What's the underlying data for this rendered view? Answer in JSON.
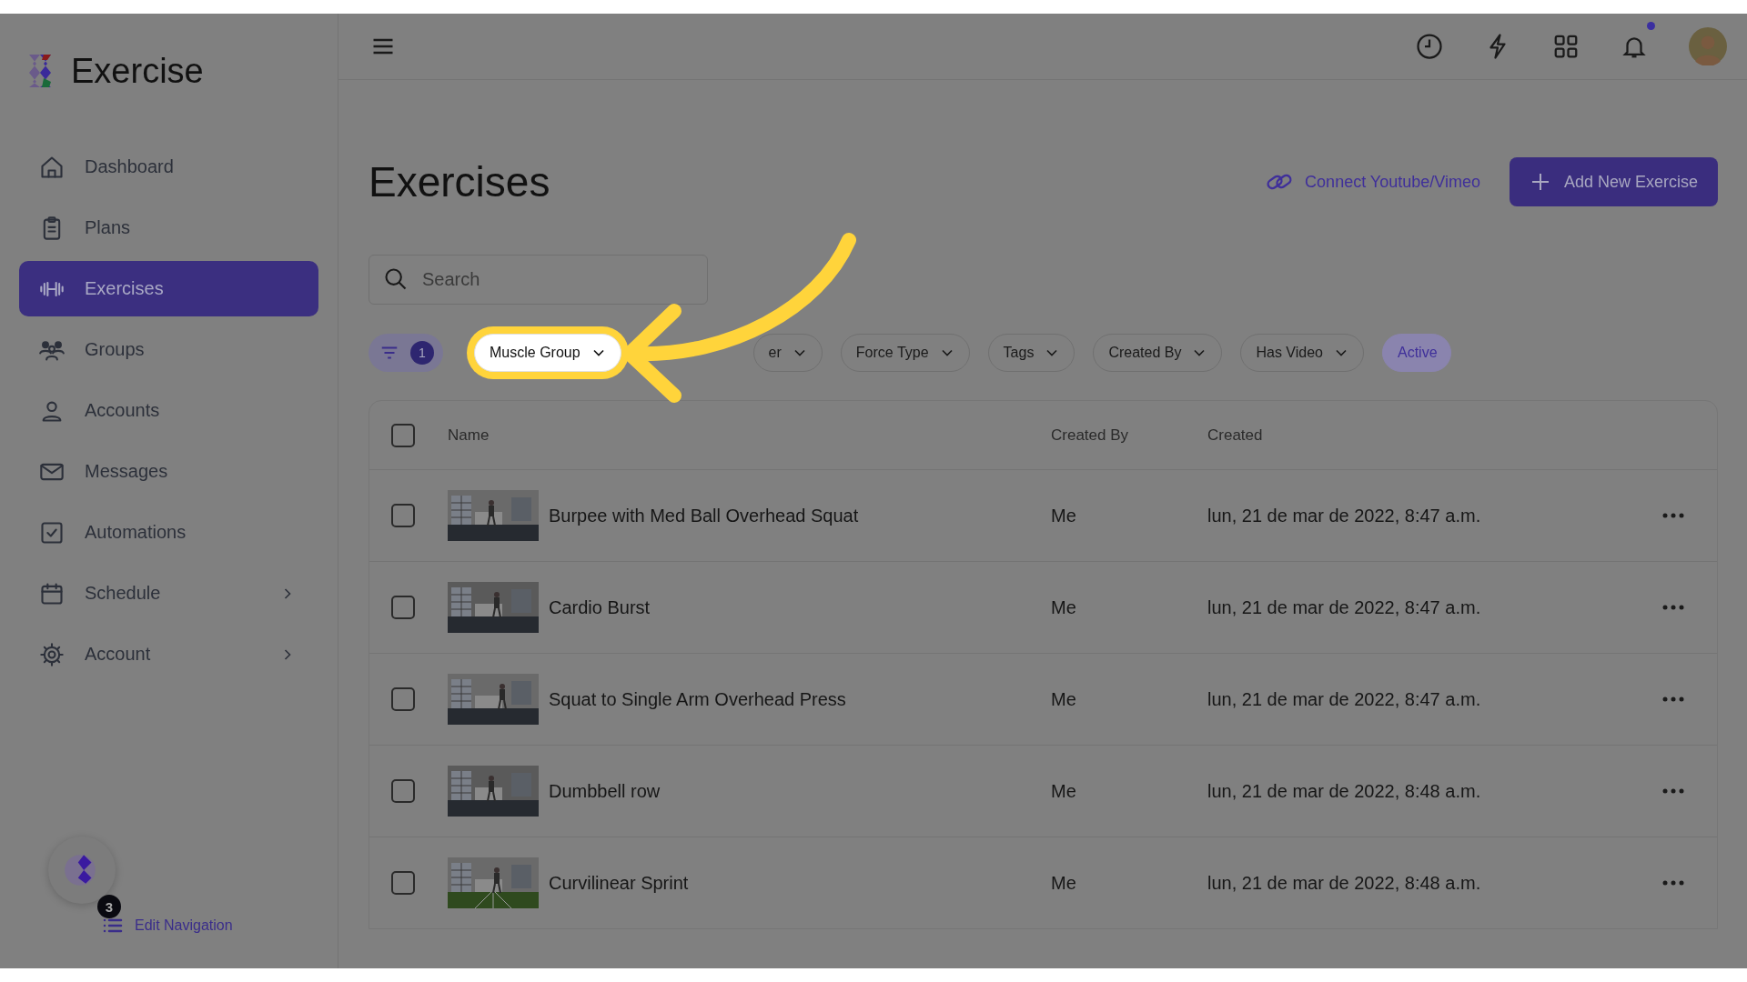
{
  "app": {
    "name": "Exercise"
  },
  "sidebar": {
    "items": [
      {
        "label": "Dashboard",
        "selected": false,
        "has_submenu": false
      },
      {
        "label": "Plans",
        "selected": false,
        "has_submenu": false
      },
      {
        "label": "Exercises",
        "selected": true,
        "has_submenu": false
      },
      {
        "label": "Groups",
        "selected": false,
        "has_submenu": false
      },
      {
        "label": "Accounts",
        "selected": false,
        "has_submenu": false
      },
      {
        "label": "Messages",
        "selected": false,
        "has_submenu": false
      },
      {
        "label": "Automations",
        "selected": false,
        "has_submenu": false
      },
      {
        "label": "Schedule",
        "selected": false,
        "has_submenu": true
      },
      {
        "label": "Account",
        "selected": false,
        "has_submenu": true
      }
    ]
  },
  "edit_navigation": {
    "badge": "3",
    "label": "Edit Navigation"
  },
  "header": {
    "unread_notifications": true
  },
  "page": {
    "title": "Exercises",
    "connect_link": "Connect Youtube/Vimeo",
    "add_button": "Add New Exercise"
  },
  "search": {
    "placeholder": "Search"
  },
  "filters": {
    "count": "1",
    "chips": [
      {
        "label": "Muscle Group",
        "highlighted": true,
        "selected": false
      },
      {
        "label": "er",
        "highlighted": false,
        "selected": false
      },
      {
        "label": "Force Type",
        "highlighted": false,
        "selected": false
      },
      {
        "label": "Tags",
        "highlighted": false,
        "selected": false
      },
      {
        "label": "Created By",
        "highlighted": false,
        "selected": false
      },
      {
        "label": "Has Video",
        "highlighted": false,
        "selected": false
      },
      {
        "label": "Active",
        "highlighted": false,
        "selected": true
      }
    ]
  },
  "table": {
    "columns": [
      "Name",
      "Created By",
      "Created"
    ],
    "all_checked": false,
    "rows": [
      {
        "name": "Burpee with Med Ball Overhead Squat",
        "created_by": "Me",
        "created": "lun, 21 de mar de 2022, 8:47 a.m.",
        "checked": false
      },
      {
        "name": "Cardio Burst",
        "created_by": "Me",
        "created": "lun, 21 de mar de 2022, 8:47 a.m.",
        "checked": false
      },
      {
        "name": "Squat to Single Arm Overhead Press",
        "created_by": "Me",
        "created": "lun, 21 de mar de 2022, 8:47 a.m.",
        "checked": false
      },
      {
        "name": "Dumbbell row",
        "created_by": "Me",
        "created": "lun, 21 de mar de 2022, 8:48 a.m.",
        "checked": false
      },
      {
        "name": "Curvilinear Sprint",
        "created_by": "Me",
        "created": "lun, 21 de mar de 2022, 8:48 a.m.",
        "checked": false
      }
    ]
  }
}
